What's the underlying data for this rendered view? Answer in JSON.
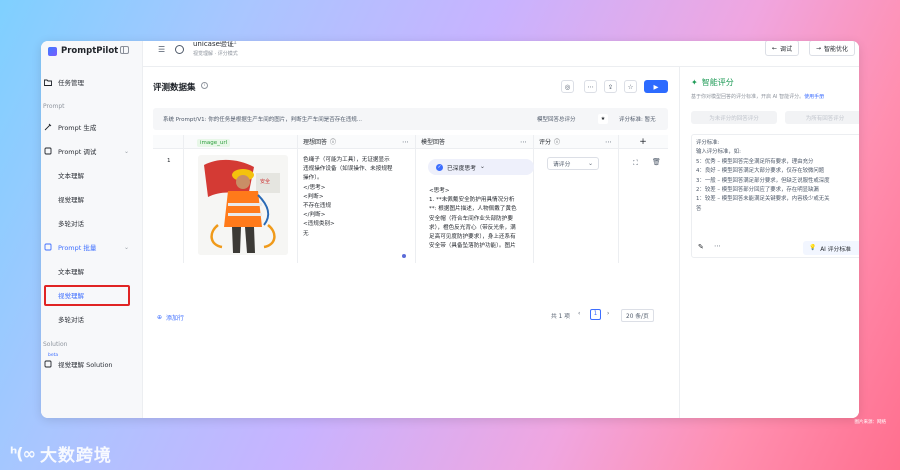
{
  "app": {
    "name": "PromptPilot"
  },
  "sidebar": {
    "task_mgmt": "任务管理",
    "prompt_section": "Prompt",
    "prompt_gen": "Prompt 生成",
    "prompt_debug": "Prompt 调试",
    "debug_items": [
      "文本理解",
      "视觉理解",
      "多轮对话"
    ],
    "prompt_batch": "Prompt 批量",
    "batch_items": [
      "文本理解",
      "视觉理解",
      "多轮对话"
    ],
    "solution_section": "Solution",
    "beta": "beta",
    "solution_item": "视觉理解 Solution"
  },
  "topbar": {
    "title": "unicase验证",
    "version": "V1",
    "subtitle": "视觉理解 · 评分模式",
    "debug_btn": "调试",
    "optimize_btn": "智能优化"
  },
  "dataset": {
    "title": "评测数据集",
    "info": "i"
  },
  "prompt_bar": {
    "text": "系统 Prompt/V1:  你的任务是根据生产车间的图片，判断生产车间是否存在违规...",
    "eval_label": "模型回答总评分",
    "eval_value": "★",
    "std_label": "评分标准: 暂无"
  },
  "table": {
    "headers": {
      "image": "image_url",
      "ideal": "理想回答",
      "model": "模型回答",
      "score": "评分"
    },
    "row": {
      "index": "1",
      "ideal_lines": [
        "色绳子（可能为工具），无证据显示",
        "违规操作设备（如误操作、未按规程",
        "操作）。",
        "</思考>",
        "<判断>",
        "不存在违规",
        "</判断>",
        "<违规类别>",
        "无"
      ],
      "model_pill": "已深度思考",
      "model_lines": [
        "<思考>",
        "1. **未佩戴安全防护用具情况分析",
        "**: 根据图片描述，人物佩戴了黄色",
        "安全帽（符合车间作业头部防护要",
        "求），橙色反光背心（带反光条，满",
        "足高可见度防护要求），身上还系有",
        "安全带（具备坠落防护功能）。图片"
      ],
      "score_placeholder": "请评分"
    }
  },
  "add_row": "添加行",
  "pagination": {
    "total": "共 1 项",
    "page": "1",
    "page_size": "20 条/页"
  },
  "right_panel": {
    "title": "智能评分",
    "desc": "基于你对模型回答的评分标准，开启 AI 智能评分。",
    "manual_link": "使用手册",
    "btn_unrated": "为未评分的回答评分",
    "btn_all": "为所有回答评分",
    "criteria_lines": [
      "评分标准:",
      "输入评分标准，如:",
      "5：优秀 – 模型回答完全满足所有要求，理由充分",
      "4：良好 – 模型回答满足大部分要求，仅存在较微问题",
      "3：一般 – 模型回答满足部分要求，但缺乏说服性或深度",
      "2：较差 – 模型回答部分回应了要求，存在明显缺漏",
      "1：较差 – 模型回答未能满足关键要求，内容极少或无关",
      "答"
    ],
    "ai_btn": "AI 评分标准"
  },
  "footer": "图片来源：网络",
  "watermark": "大数跨境"
}
